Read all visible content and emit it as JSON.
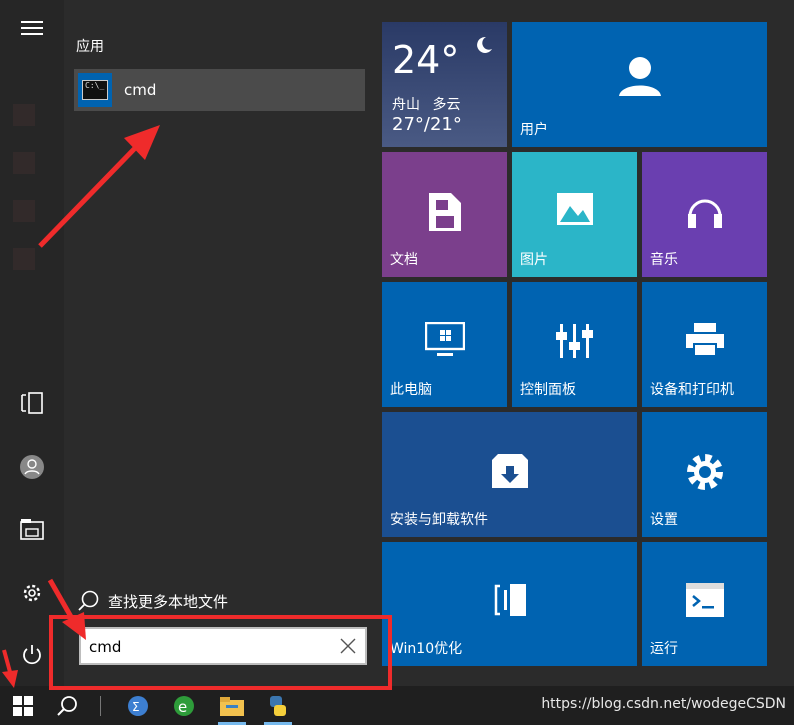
{
  "apps_header": "应用",
  "best_match": {
    "name": "cmd"
  },
  "more_files_label": "查找更多本地文件",
  "search": {
    "value": "cmd"
  },
  "weather": {
    "temp": "24°",
    "city": "舟山",
    "condition": "多云",
    "range": "27°/21°"
  },
  "tiles": {
    "user": "用户",
    "documents": "文档",
    "pictures": "图片",
    "music": "音乐",
    "this_pc": "此电脑",
    "control_panel": "控制面板",
    "devices_printers": "设备和打印机",
    "install_uninstall": "安装与卸载软件",
    "settings": "设置",
    "win10_optimize": "Win10优化",
    "run": "运行"
  },
  "watermark": "https://blog.csdn.net/wodegeCSDN",
  "colors": {
    "tile_blue": "#0063b1",
    "documents": "#7b3f8c",
    "pictures": "#2bb5c8",
    "music": "#6a3fb0",
    "install": "#1b4f91",
    "annotation_red": "#ef2b2b"
  }
}
